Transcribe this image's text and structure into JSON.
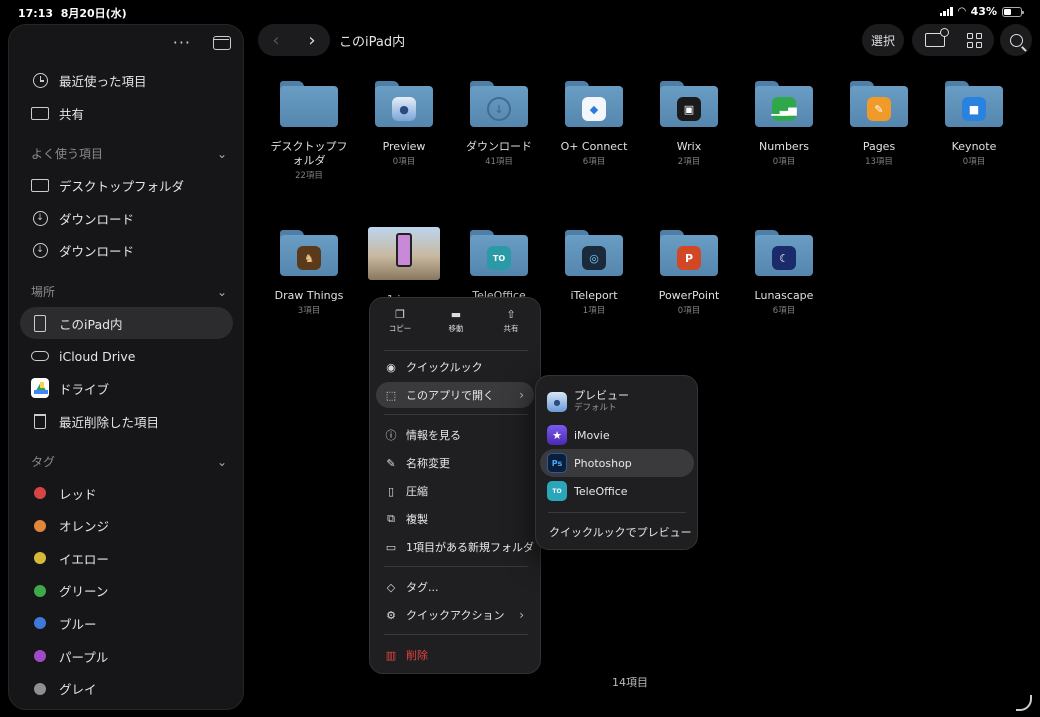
{
  "status": {
    "time": "17:13",
    "date": "8月20日(水)",
    "battery": "43%",
    "battery_level": 0.43
  },
  "sidebar": {
    "recent": "最近使った項目",
    "shared": "共有",
    "favorites_header": "よく使う項目",
    "favorites": [
      "デスクトップフォルダ",
      "ダウンロード",
      "ダウンロード"
    ],
    "locations_header": "場所",
    "locations": [
      "このiPad内",
      "iCloud Drive",
      "ドライブ",
      "最近削除した項目"
    ],
    "tags_header": "タグ",
    "tags": [
      {
        "label": "レッド",
        "color": "#d64545"
      },
      {
        "label": "オレンジ",
        "color": "#e0873a"
      },
      {
        "label": "イエロー",
        "color": "#d8b838"
      },
      {
        "label": "グリーン",
        "color": "#3fa84a"
      },
      {
        "label": "ブルー",
        "color": "#3f78d8"
      },
      {
        "label": "パープル",
        "color": "#a04ac8"
      },
      {
        "label": "グレイ",
        "color": "#8e8e93"
      }
    ]
  },
  "toolbar": {
    "title": "このiPad内",
    "select": "選択"
  },
  "files": [
    {
      "name": "デスクトップフォルダ",
      "count": "22項目"
    },
    {
      "name": "Preview",
      "count": "0項目"
    },
    {
      "name": "ダウンロード",
      "count": "41項目"
    },
    {
      "name": "O+ Connect",
      "count": "6項目"
    },
    {
      "name": "Wrix",
      "count": "2項目"
    },
    {
      "name": "Numbers",
      "count": "0項目"
    },
    {
      "name": "Pages",
      "count": "13項目"
    },
    {
      "name": "Keynote",
      "count": "0項目"
    },
    {
      "name": "Draw Things",
      "count": "3項目"
    },
    {
      "name": "1.jpeg",
      "count": ""
    },
    {
      "name": "TeleOffice",
      "count": ""
    },
    {
      "name": "iTeleport",
      "count": "1項目"
    },
    {
      "name": "PowerPoint",
      "count": "0項目"
    },
    {
      "name": "Lunascape",
      "count": "6項目"
    }
  ],
  "menu": {
    "copy": "コピー",
    "move": "移動",
    "share": "共有",
    "quicklook": "クイックルック",
    "open_with": "このアプリで開く",
    "info": "情報を見る",
    "rename": "名称変更",
    "compress": "圧縮",
    "duplicate": "複製",
    "new_folder": "1項目がある新規フォルダ",
    "tags": "タグ...",
    "quick_actions": "クイックアクション",
    "delete": "削除"
  },
  "submenu": {
    "preview": "プレビュー",
    "preview_sub": "デフォルト",
    "imovie": "iMovie",
    "photoshop": "Photoshop",
    "teleoffice": "TeleOffice",
    "quicklook_preview": "クイックルックでプレビュー"
  },
  "footer": "14項目"
}
